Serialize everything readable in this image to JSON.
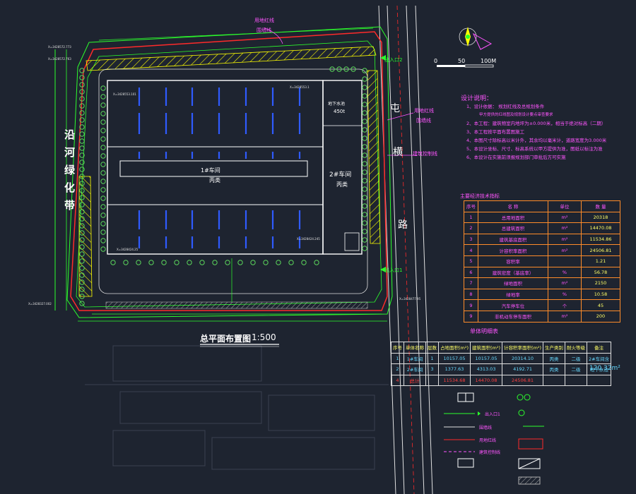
{
  "drawing": {
    "title": "总平面布置图",
    "scale": "1:500",
    "scale_bar": [
      "0",
      "50",
      "100M"
    ],
    "road_label": [
      "屯",
      "横",
      "路"
    ],
    "green_belt": [
      "沿",
      "河",
      "绿",
      "化",
      "带"
    ],
    "building_1": [
      "1#车间",
      "丙类"
    ],
    "building_2": [
      "2#车间",
      "丙类"
    ],
    "underground": [
      "地下水池",
      "450t"
    ],
    "red_line": "用地红线",
    "wall_line": "围墙线",
    "setback_line": "建筑控制线",
    "gate_1": "出入口1",
    "gate_2": "出入口2"
  },
  "notes": {
    "title": "设计说明：",
    "lines": [
      "1、设计依据：   规划红线及总规划条件",
      "   甲方提供的红线图及规划设计要点审查要求",
      "2、本工程：建筑物室内地坪为±0.000米，相当于绝对标高（二期）",
      "3、本工程按平面布置图施工",
      "4、本图尺寸除标高以米计外，其余均以毫米计，道路宽度为3.000米",
      "5、本设计坐标、尺寸、标高系统以甲方提供为准，图纸以标注为准",
      "6、本设计在实施前须报规划部门审批后方可实施"
    ]
  },
  "tech_table": {
    "title": "主要经济技术指标",
    "headers": [
      "序号",
      "名  称",
      "单位",
      "数  量"
    ],
    "rows": [
      [
        "1",
        "总用地面积",
        "m²",
        "20318"
      ],
      [
        "2",
        "总建筑面积",
        "m²",
        "14470.08"
      ],
      [
        "3",
        "建筑基底面积",
        "m²",
        "11534.86"
      ],
      [
        "4",
        "计容积率面积",
        "m²",
        "24506.81"
      ],
      [
        "5",
        "容积率",
        "",
        "1.21"
      ],
      [
        "6",
        "建筑密度（基底率）",
        "%",
        "56.78"
      ],
      [
        "7",
        "绿地面积",
        "m²",
        "2150"
      ],
      [
        "8",
        "绿地率",
        "%",
        "10.58"
      ],
      [
        "9",
        "汽车停车位",
        "个",
        "45"
      ],
      [
        "9",
        "非机动车停车面积",
        "m²",
        "200"
      ]
    ]
  },
  "unit_table": {
    "title": "单体明细表",
    "headers": [
      "序号",
      "单体名称",
      "层数",
      "占地面积(m²)",
      "建筑面积(m²)",
      "计容积率面积(m²)",
      "生产类别",
      "耐火等级",
      "备注"
    ],
    "rows": [
      [
        "1",
        "1#车间",
        "1",
        "10157.05",
        "10157.05",
        "20314.10",
        "丙类",
        "二级",
        "2#车间含"
      ],
      [
        "2",
        "2#车间",
        "3",
        "1377.63",
        "4313.03",
        "4192.71",
        "丙类",
        "二级",
        "地下水池"
      ],
      [
        "4",
        "总计",
        "",
        "11534.68",
        "14470.08",
        "24506.81",
        "",
        "",
        ""
      ]
    ],
    "extra_area": "120.32m²"
  },
  "colors": {
    "background": "#1e2430",
    "boundary": "#2cff2c",
    "hatch": "#ffff00",
    "red_line": "#ff2a2a",
    "magenta": "#ff55ff",
    "blue_bar": "#2f5bff",
    "tree": "#5bd65b"
  }
}
